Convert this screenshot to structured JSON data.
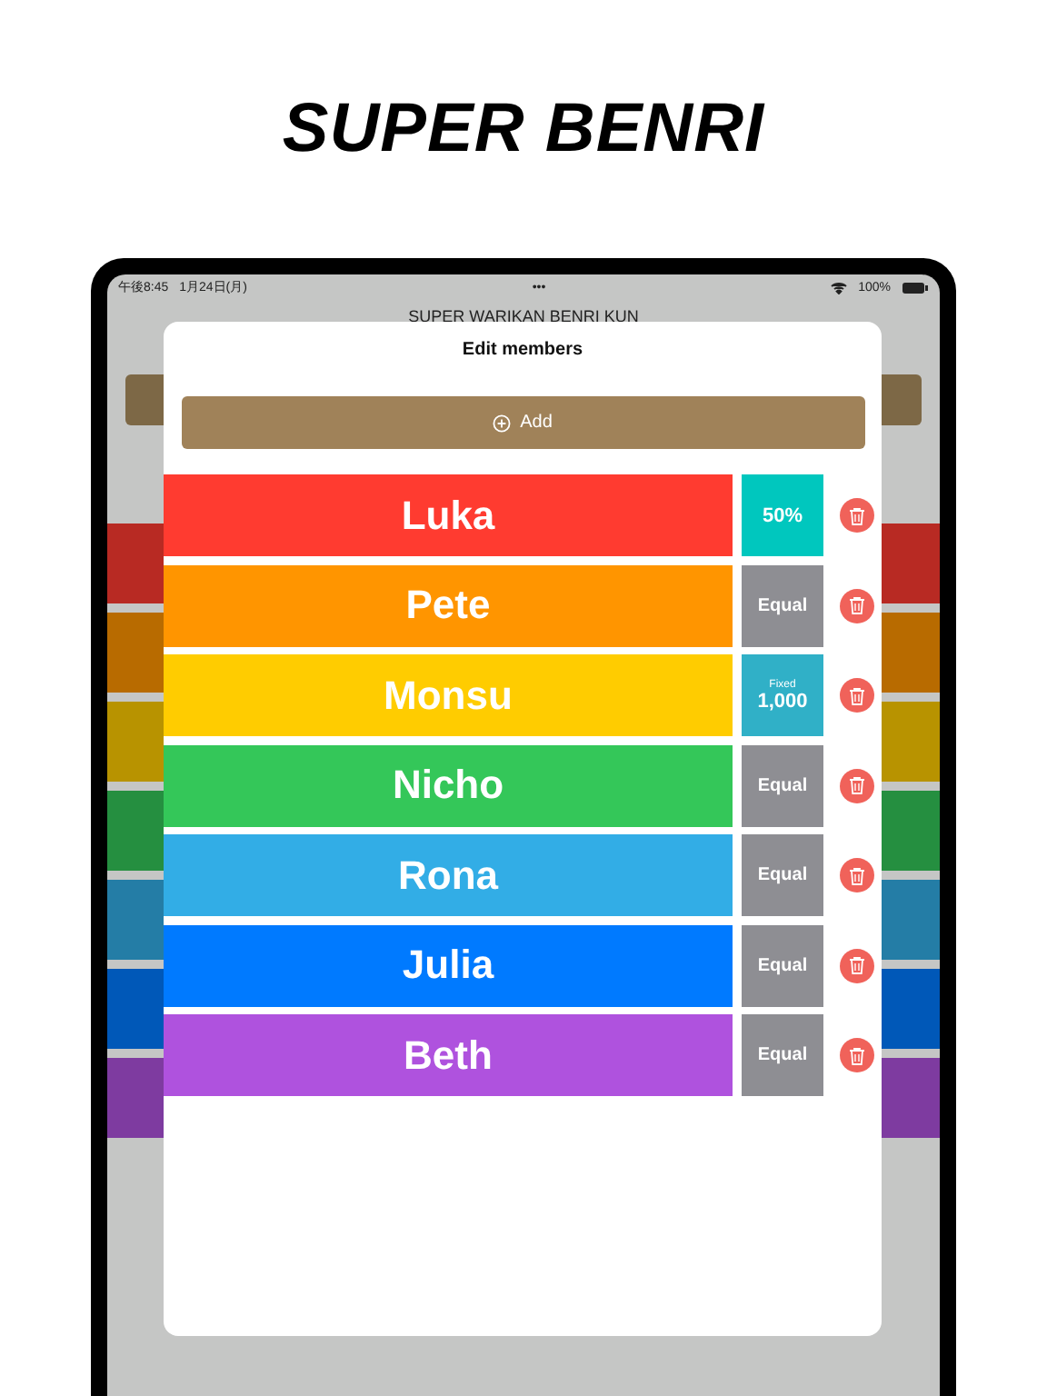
{
  "headline": "SUPER BENRI",
  "status_bar": {
    "time": "午後8:45",
    "date": "1月24日(月)",
    "dots": "•••",
    "battery": "100%"
  },
  "app": {
    "title": "SUPER WARIKAN BENRI KUN"
  },
  "modal": {
    "title": "Edit members",
    "add_button": "Add"
  },
  "members": [
    {
      "name": "Luka",
      "color": "#ff3b30",
      "kind": "percent",
      "value": "50%"
    },
    {
      "name": "Pete",
      "color": "#ff9500",
      "kind": "equal",
      "value": "Equal"
    },
    {
      "name": "Monsu",
      "color": "#ffcc00",
      "kind": "fixed",
      "caption": "Fixed",
      "value": "1,000"
    },
    {
      "name": "Nicho",
      "color": "#34c759",
      "kind": "equal",
      "value": "Equal"
    },
    {
      "name": "Rona",
      "color": "#32ade6",
      "kind": "equal",
      "value": "Equal"
    },
    {
      "name": "Julia",
      "color": "#007aff",
      "kind": "equal",
      "value": "Equal"
    },
    {
      "name": "Beth",
      "color": "#af52de",
      "kind": "equal",
      "value": "Equal"
    }
  ]
}
